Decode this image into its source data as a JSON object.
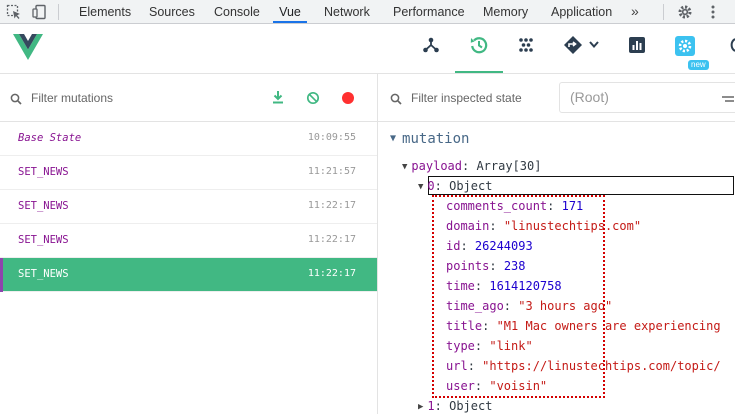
{
  "devtools": {
    "tabs": [
      "Elements",
      "Sources",
      "Console",
      "Vue",
      "Network",
      "Performance",
      "Memory",
      "Application"
    ],
    "active_tab": "Vue",
    "more": "»"
  },
  "toolbar": {
    "new_badge": "new",
    "accent": "#41b883"
  },
  "left": {
    "filter_placeholder": "Filter mutations",
    "mutations": [
      {
        "name": "Base State",
        "time": "10:09:55"
      },
      {
        "name": "SET_NEWS",
        "time": "11:21:57"
      },
      {
        "name": "SET_NEWS",
        "time": "11:22:17"
      },
      {
        "name": "SET_NEWS",
        "time": "11:22:17"
      },
      {
        "name": "SET_NEWS",
        "time": "11:22:17"
      }
    ],
    "selected_index": 4
  },
  "right": {
    "filter_placeholder": "Filter inspected state",
    "root_select": "(Root)",
    "section": "mutation",
    "payload_key": "payload",
    "payload_type": "Array[30]",
    "item0_label": "0",
    "item0_type": "Object",
    "fields": [
      {
        "key": "comments_count",
        "value": "171",
        "kind": "num"
      },
      {
        "key": "domain",
        "value": "\"linustechtips.com\"",
        "kind": "str"
      },
      {
        "key": "id",
        "value": "26244093",
        "kind": "num"
      },
      {
        "key": "points",
        "value": "238",
        "kind": "num"
      },
      {
        "key": "time",
        "value": "1614120758",
        "kind": "num"
      },
      {
        "key": "time_ago",
        "value": "\"3 hours ago\"",
        "kind": "str"
      },
      {
        "key": "title",
        "value": "\"M1 Mac owners are experiencing",
        "kind": "str"
      },
      {
        "key": "type",
        "value": "\"link\"",
        "kind": "str"
      },
      {
        "key": "url",
        "value": "\"https://linustechtips.com/topic/",
        "kind": "str"
      },
      {
        "key": "user",
        "value": "\"voisin\"",
        "kind": "str"
      }
    ],
    "item1_label": "1",
    "item1_type": "Object"
  }
}
